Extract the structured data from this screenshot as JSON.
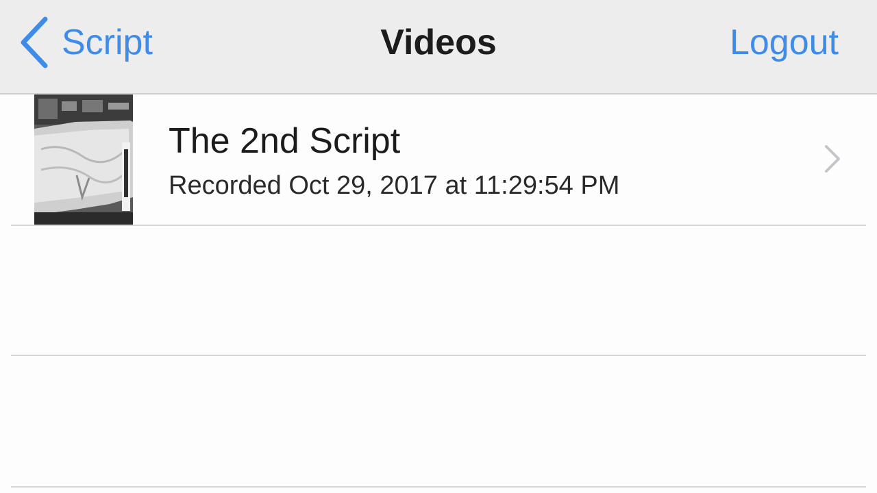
{
  "navbar": {
    "back_label": "Script",
    "back_icon": "chevron-left-icon",
    "title": "Videos",
    "logout_label": "Logout",
    "accent_color": "#3e8ce8"
  },
  "videos": [
    {
      "title": "The 2nd Script",
      "subtitle": "Recorded Oct 29, 2017 at 11:29:54 PM",
      "thumbnail_icon": "video-thumbnail",
      "accessory_icon": "chevron-right-icon"
    }
  ]
}
